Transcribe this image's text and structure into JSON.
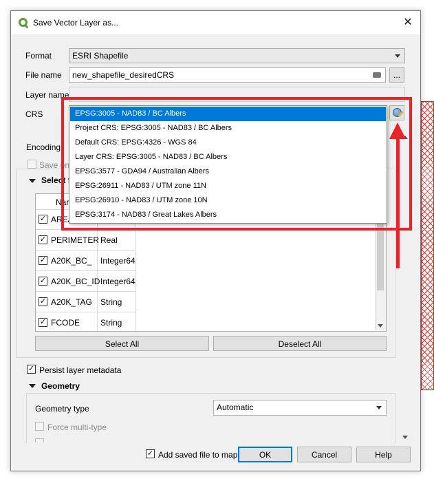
{
  "window": {
    "title": "Save Vector Layer as...",
    "close_glyph": "✕"
  },
  "form": {
    "format_label": "Format",
    "format_value": "ESRI Shapefile",
    "filename_label": "File name",
    "filename_value": "new_shapefile_desiredCRS",
    "browse_label": "...",
    "layername_label": "Layer name",
    "crs_label": "CRS",
    "encoding_label": "Encoding",
    "save_only_label": "Save onl"
  },
  "select_fields": {
    "header": "Select f",
    "col_name": "Nar",
    "rows": [
      {
        "checked": "✓",
        "name": "AREA",
        "type": ""
      },
      {
        "checked": "✓",
        "name": "PERIMETER",
        "type": "Real"
      },
      {
        "checked": "✓",
        "name": "A20K_BC_",
        "type": "Integer64"
      },
      {
        "checked": "✓",
        "name": "A20K_BC_ID",
        "type": "Integer64"
      },
      {
        "checked": "✓",
        "name": "A20K_TAG",
        "type": "String"
      },
      {
        "checked": "✓",
        "name": "FCODE",
        "type": "String"
      }
    ],
    "select_all": "Select All",
    "deselect_all": "Deselect All"
  },
  "persist": {
    "checked": "✓",
    "label": "Persist layer metadata"
  },
  "geometry": {
    "header": "Geometry",
    "type_label": "Geometry type",
    "type_value": "Automatic",
    "force_multi": "Force multi-type"
  },
  "footer": {
    "add_saved_checked": "✓",
    "add_saved_label": "Add saved file to map",
    "ok": "OK",
    "cancel": "Cancel",
    "help": "Help"
  },
  "crs_dropdown": {
    "items": [
      "EPSG:3005 - NAD83 / BC Albers",
      "Project CRS: EPSG:3005 - NAD83 / BC Albers",
      "Default CRS: EPSG:4326 - WGS 84",
      "Layer CRS: EPSG:3005 - NAD83 / BC Albers",
      "EPSG:3577 - GDA94 / Australian Albers",
      "EPSG:26911 - NAD83 / UTM zone 11N",
      "EPSG:26910 - NAD83 / UTM zone 10N",
      "EPSG:3174 - NAD83 / Great Lakes Albers"
    ]
  },
  "colors": {
    "highlight": "#0078d7",
    "annotation": "#e8232b",
    "qgis_green": "#5b9c2f"
  }
}
